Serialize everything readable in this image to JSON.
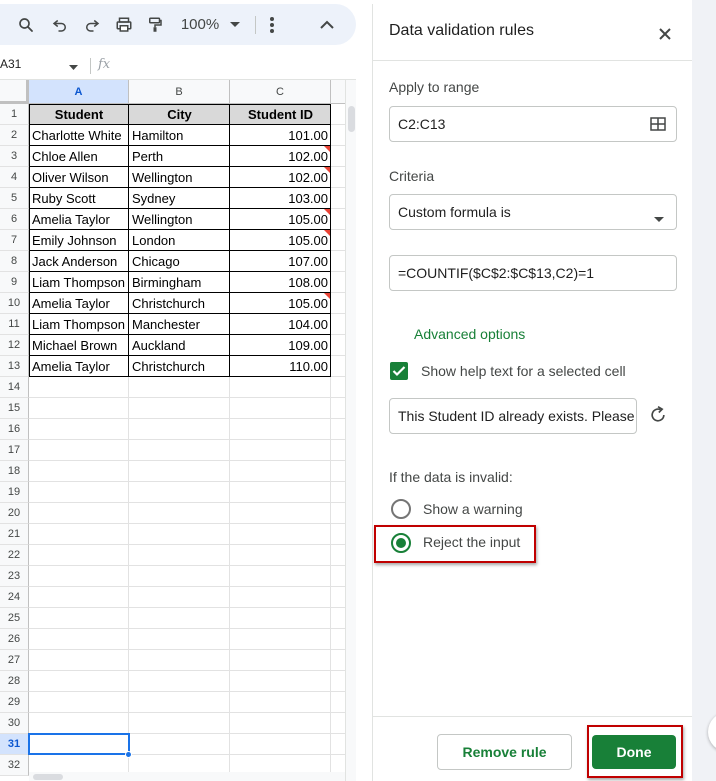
{
  "toolbar": {
    "zoom": "100%",
    "icons": [
      "search-icon",
      "undo-icon",
      "redo-icon",
      "print-icon",
      "paint-format-icon",
      "more-vert-icon",
      "chevron-up-icon"
    ]
  },
  "formula_bar": {
    "name_box": "A31",
    "fx_label": "fx"
  },
  "grid": {
    "columns": [
      "A",
      "B",
      "C"
    ],
    "rows": [
      "1",
      "2",
      "3",
      "4",
      "5",
      "6",
      "7",
      "8",
      "9",
      "10",
      "11",
      "12",
      "13",
      "14",
      "15",
      "16",
      "17",
      "18",
      "19",
      "20",
      "21",
      "22",
      "23",
      "24",
      "25",
      "26",
      "27",
      "28",
      "29",
      "30",
      "31",
      "32"
    ],
    "selected_row": "31",
    "selected_column": "A",
    "header": {
      "student": "Student",
      "city": "City",
      "student_id": "Student ID"
    },
    "records": [
      {
        "student": "Charlotte White",
        "city": "Hamilton",
        "id": "101.00",
        "flag": false
      },
      {
        "student": "Chloe Allen",
        "city": "Perth",
        "id": "102.00",
        "flag": true
      },
      {
        "student": "Oliver Wilson",
        "city": "Wellington",
        "id": "102.00",
        "flag": true
      },
      {
        "student": "Ruby Scott",
        "city": "Sydney",
        "id": "103.00",
        "flag": false
      },
      {
        "student": "Amelia Taylor",
        "city": "Wellington",
        "id": "105.00",
        "flag": true
      },
      {
        "student": "Emily Johnson",
        "city": "London",
        "id": "105.00",
        "flag": true
      },
      {
        "student": "Jack Anderson",
        "city": "Chicago",
        "id": "107.00",
        "flag": false
      },
      {
        "student": "Liam Thompson",
        "city": "Birmingham",
        "id": "108.00",
        "flag": false
      },
      {
        "student": "Amelia Taylor",
        "city": "Christchurch",
        "id": "105.00",
        "flag": true
      },
      {
        "student": "Liam Thompson",
        "city": "Manchester",
        "id": "104.00",
        "flag": false
      },
      {
        "student": "Michael Brown",
        "city": "Auckland",
        "id": "109.00",
        "flag": false
      },
      {
        "student": "Amelia Taylor",
        "city": "Christchurch",
        "id": "110.00",
        "flag": false
      }
    ]
  },
  "panel": {
    "title": "Data validation rules",
    "apply_label": "Apply to range",
    "range_value": "C2:C13",
    "criteria_label": "Criteria",
    "criteria_value": "Custom formula is",
    "formula_value": "=COUNTIF($C$2:$C$13,C2)=1",
    "advanced_label": "Advanced options",
    "help_checkbox_label": "Show help text for a selected cell",
    "help_checked": true,
    "help_text_value": "This Student ID already exists. Please",
    "invalid_label": "If the data is invalid:",
    "option_warning": "Show a warning",
    "option_reject": "Reject the input",
    "selected_option": "reject",
    "remove_button": "Remove rule",
    "done_button": "Done"
  },
  "colors": {
    "accent_green": "#188038",
    "highlight_red": "#c00000",
    "selection_blue": "#1a73e8",
    "header_gray": "#d9d9d9",
    "error_flag": "#ea4335"
  }
}
